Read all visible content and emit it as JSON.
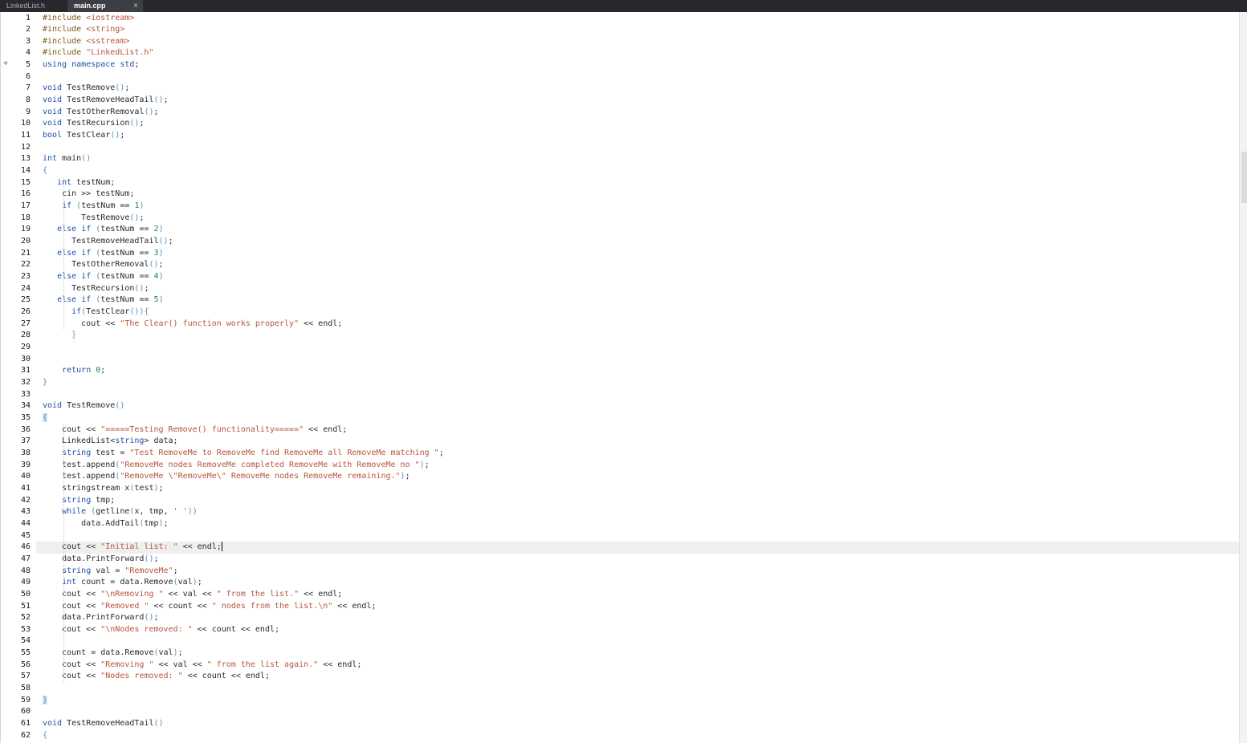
{
  "tabs": [
    {
      "label": "LinkedList.h",
      "active": false
    },
    {
      "label": "main.cpp",
      "active": true,
      "close": "×"
    }
  ],
  "editor": {
    "current_line": 46,
    "lines": [
      "#include <iostream>",
      "#include <string>",
      "#include <sstream>",
      "#include \"LinkedList.h\"",
      "using namespace std;",
      "",
      "void TestRemove();",
      "void TestRemoveHeadTail();",
      "void TestOtherRemoval();",
      "void TestRecursion();",
      "bool TestClear();",
      "",
      "int main()",
      "{",
      "   int testNum;",
      "    cin >> testNum;",
      "    if (testNum == 1)",
      "        TestRemove();",
      "   else if (testNum == 2)",
      "      TestRemoveHeadTail();",
      "   else if (testNum == 3)",
      "      TestOtherRemoval();",
      "   else if (testNum == 4)",
      "      TestRecursion();",
      "   else if (testNum == 5)",
      "      if(TestClear()){",
      "        cout << \"The Clear() function works properly\" << endl;",
      "      }",
      "",
      "",
      "    return 0;",
      "}",
      "",
      "void TestRemove()",
      "{",
      "    cout << \"=====Testing Remove() functionality=====\" << endl;",
      "    LinkedList<string> data;",
      "    string test = \"Test RemoveMe to RemoveMe find RemoveMe all RemoveMe matching \";",
      "    test.append(\"RemoveMe nodes RemoveMe completed RemoveMe with RemoveMe no \");",
      "    test.append(\"RemoveMe \\\"RemoveMe\\\" RemoveMe nodes RemoveMe remaining.\");",
      "    stringstream x(test);",
      "    string tmp;",
      "    while (getline(x, tmp, ' '))",
      "        data.AddTail(tmp);",
      "",
      "    cout << \"Initial list: \" << endl;",
      "    data.PrintForward();",
      "    string val = \"RemoveMe\";",
      "    int count = data.Remove(val);",
      "    cout << \"\\nRemoving \" << val << \" from the list.\" << endl;",
      "    cout << \"Removed \" << count << \" nodes from the list.\\n\" << endl;",
      "    data.PrintForward();",
      "    cout << \"\\nNodes removed: \" << count << endl;",
      "",
      "    count = data.Remove(val);",
      "    cout << \"Removing \" << val << \" from the list again.\" << endl;",
      "    cout << \"Nodes removed: \" << count << endl;",
      "",
      "}",
      "",
      "void TestRemoveHeadTail()",
      "{"
    ]
  }
}
